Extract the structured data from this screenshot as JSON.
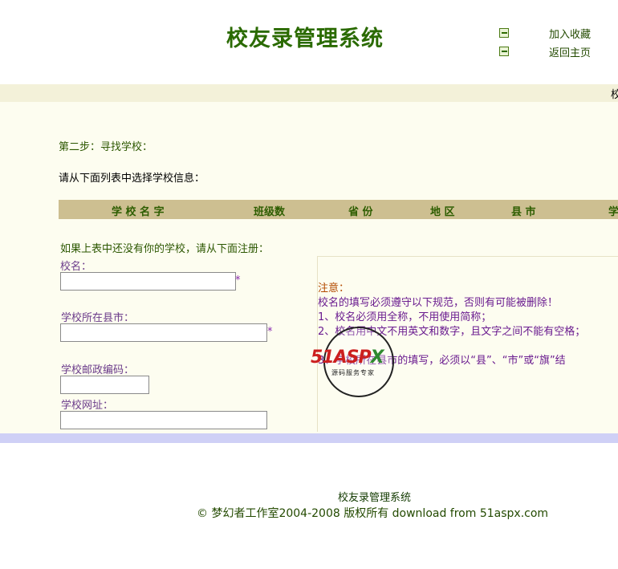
{
  "header": {
    "title": "校友录管理系统",
    "links": [
      {
        "label": "加入收藏",
        "icon": "arrow-in-icon"
      },
      {
        "label": "返回主页",
        "icon": "arrow-in-icon"
      }
    ]
  },
  "band": {
    "text": "校"
  },
  "main": {
    "step": "第二步：寻找学校：",
    "choose": "请从下面列表中选择学校信息：",
    "table": {
      "headers": [
        "学 校 名 字",
        "班级数",
        "省 份",
        "地 区",
        "县 市",
        "学"
      ]
    },
    "notice": "如果上表中还没有你的学校，请从下面注册：",
    "form": {
      "school_name_label": "校名：",
      "county_label": "学校所在县市：",
      "postcode_label": "学校邮政编码：",
      "website_label": "学校网址：",
      "required_mark": "*"
    },
    "note": {
      "title": "注意：",
      "lines": [
        "校名的填写必须遵守以下规范，否则有可能被删除！",
        "1、校名必须用全称，不用使用简称；",
        "2、校名用中文不用英文和数字，且文字之间不能有空格；",
        "3、学校所在县市的填写，必须以“县”、“市”或“旗”结"
      ]
    }
  },
  "watermark": {
    "logo_main": "51ASP",
    "logo_x": "X",
    "sub": "源码服务专家"
  },
  "footer": {
    "title": "校友录管理系统",
    "copyright": "© 梦幻者工作室2004-2008 版权所有 download from 51aspx.com"
  }
}
